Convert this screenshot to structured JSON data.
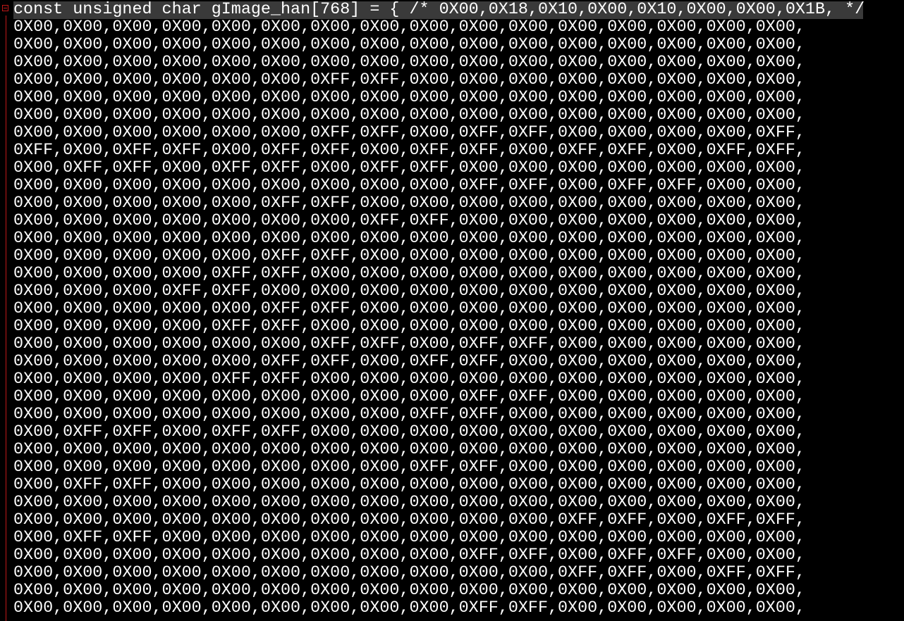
{
  "editor": {
    "header_line": "const unsigned char gImage_han[768] = { /* 0X00,0X18,0X10,0X00,0X10,0X00,0X00,0X1B, */",
    "lines": [
      "0X00,0X00,0X00,0X00,0X00,0X00,0X00,0X00,0X00,0X00,0X00,0X00,0X00,0X00,0X00,0X00,",
      "0X00,0X00,0X00,0X00,0X00,0X00,0X00,0X00,0X00,0X00,0X00,0X00,0X00,0X00,0X00,0X00,",
      "0X00,0X00,0X00,0X00,0X00,0X00,0X00,0X00,0X00,0X00,0X00,0X00,0X00,0X00,0X00,0X00,",
      "0X00,0X00,0X00,0X00,0X00,0X00,0XFF,0XFF,0X00,0X00,0X00,0X00,0X00,0X00,0X00,0X00,",
      "0X00,0X00,0X00,0X00,0X00,0X00,0X00,0X00,0X00,0X00,0X00,0X00,0X00,0X00,0X00,0X00,",
      "0X00,0X00,0X00,0X00,0X00,0X00,0X00,0X00,0X00,0X00,0X00,0X00,0X00,0X00,0X00,0X00,",
      "0X00,0X00,0X00,0X00,0X00,0X00,0XFF,0XFF,0X00,0XFF,0XFF,0X00,0X00,0X00,0X00,0XFF,",
      "0XFF,0X00,0XFF,0XFF,0X00,0XFF,0XFF,0X00,0XFF,0XFF,0X00,0XFF,0XFF,0X00,0XFF,0XFF,",
      "0X00,0XFF,0XFF,0X00,0XFF,0XFF,0X00,0XFF,0XFF,0X00,0X00,0X00,0X00,0X00,0X00,0X00,",
      "0X00,0X00,0X00,0X00,0X00,0X00,0X00,0X00,0X00,0XFF,0XFF,0X00,0XFF,0XFF,0X00,0X00,",
      "0X00,0X00,0X00,0X00,0X00,0XFF,0XFF,0X00,0X00,0X00,0X00,0X00,0X00,0X00,0X00,0X00,",
      "0X00,0X00,0X00,0X00,0X00,0X00,0X00,0XFF,0XFF,0X00,0X00,0X00,0X00,0X00,0X00,0X00,",
      "0X00,0X00,0X00,0X00,0X00,0X00,0X00,0X00,0X00,0X00,0X00,0X00,0X00,0X00,0X00,0X00,",
      "0X00,0X00,0X00,0X00,0X00,0XFF,0XFF,0X00,0X00,0X00,0X00,0X00,0X00,0X00,0X00,0X00,",
      "0X00,0X00,0X00,0X00,0XFF,0XFF,0X00,0X00,0X00,0X00,0X00,0X00,0X00,0X00,0X00,0X00,",
      "0X00,0X00,0X00,0XFF,0XFF,0X00,0X00,0X00,0X00,0X00,0X00,0X00,0X00,0X00,0X00,0X00,",
      "0X00,0X00,0X00,0X00,0X00,0XFF,0XFF,0X00,0X00,0X00,0X00,0X00,0X00,0X00,0X00,0X00,",
      "0X00,0X00,0X00,0X00,0XFF,0XFF,0X00,0X00,0X00,0X00,0X00,0X00,0X00,0X00,0X00,0X00,",
      "0X00,0X00,0X00,0X00,0X00,0X00,0XFF,0XFF,0X00,0XFF,0XFF,0X00,0X00,0X00,0X00,0X00,",
      "0X00,0X00,0X00,0X00,0X00,0XFF,0XFF,0X00,0XFF,0XFF,0X00,0X00,0X00,0X00,0X00,0X00,",
      "0X00,0X00,0X00,0X00,0XFF,0XFF,0X00,0X00,0X00,0X00,0X00,0X00,0X00,0X00,0X00,0X00,",
      "0X00,0X00,0X00,0X00,0X00,0X00,0X00,0X00,0X00,0XFF,0XFF,0X00,0X00,0X00,0X00,0X00,",
      "0X00,0X00,0X00,0X00,0X00,0X00,0X00,0X00,0XFF,0XFF,0X00,0X00,0X00,0X00,0X00,0X00,",
      "0X00,0XFF,0XFF,0X00,0XFF,0XFF,0X00,0X00,0X00,0X00,0X00,0X00,0X00,0X00,0X00,0X00,",
      "0X00,0X00,0X00,0X00,0X00,0X00,0X00,0X00,0X00,0X00,0X00,0X00,0X00,0X00,0X00,0X00,",
      "0X00,0X00,0X00,0X00,0X00,0X00,0X00,0X00,0XFF,0XFF,0X00,0X00,0X00,0X00,0X00,0X00,",
      "0X00,0XFF,0XFF,0X00,0X00,0X00,0X00,0X00,0X00,0X00,0X00,0X00,0X00,0X00,0X00,0X00,",
      "0X00,0X00,0X00,0X00,0X00,0X00,0X00,0X00,0X00,0X00,0X00,0X00,0X00,0X00,0X00,0X00,",
      "0X00,0X00,0X00,0X00,0X00,0X00,0X00,0X00,0X00,0X00,0X00,0XFF,0XFF,0X00,0XFF,0XFF,",
      "0X00,0XFF,0XFF,0X00,0X00,0X00,0X00,0X00,0X00,0X00,0X00,0X00,0X00,0X00,0X00,0X00,",
      "0X00,0X00,0X00,0X00,0X00,0X00,0X00,0X00,0X00,0XFF,0XFF,0X00,0XFF,0XFF,0X00,0X00,",
      "0X00,0X00,0X00,0X00,0X00,0X00,0X00,0X00,0X00,0X00,0X00,0XFF,0XFF,0X00,0XFF,0XFF,",
      "0X00,0X00,0X00,0X00,0X00,0X00,0X00,0X00,0X00,0X00,0X00,0X00,0X00,0X00,0X00,0X00,",
      "0X00,0X00,0X00,0X00,0X00,0X00,0X00,0X00,0X00,0XFF,0XFF,0X00,0X00,0X00,0X00,0X00,"
    ]
  },
  "colors": {
    "background": "#000000",
    "text": "#ffffff",
    "current_line_highlight": "#3a3a3a",
    "fold_marker": "#c01818"
  },
  "icons": {
    "fold_marker": "fold-collapse-icon"
  }
}
